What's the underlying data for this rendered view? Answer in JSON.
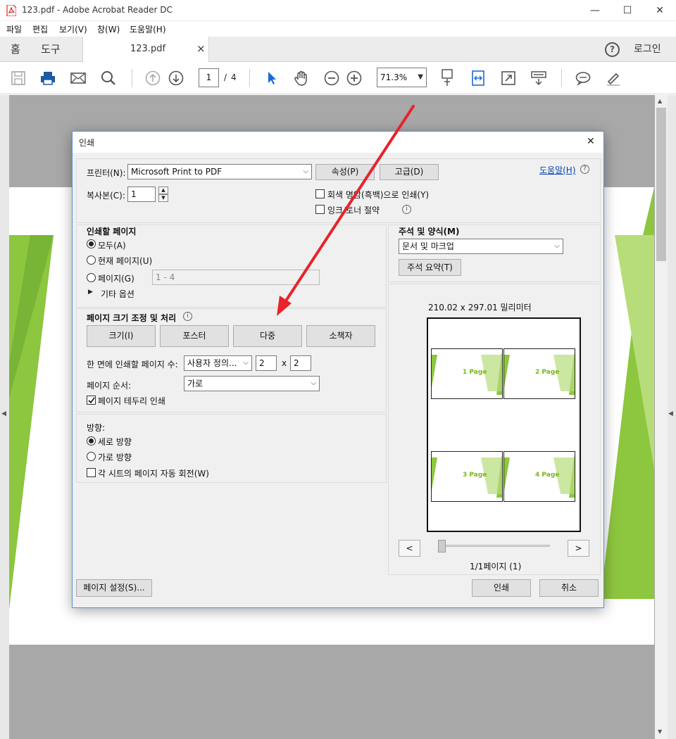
{
  "window": {
    "title": "123.pdf - Adobe Acrobat Reader DC",
    "minimize": "—",
    "maximize": "☐",
    "close": "✕"
  },
  "menu": [
    "파일",
    "편집",
    "보기(V)",
    "창(W)",
    "도움말(H)"
  ],
  "tabs": {
    "home": "홈",
    "tools": "도구",
    "doc": "123.pdf",
    "doc_close": "×",
    "login": "로그인",
    "help": "?"
  },
  "toolbar": {
    "page_current": "1",
    "page_sep": "/",
    "page_total": "4",
    "zoom": "71.3%"
  },
  "dialog": {
    "title": "인쇄",
    "close": "✕",
    "printer_label": "프린터(N):",
    "printer_value": "Microsoft Print to PDF",
    "properties_btn": "속성(P)",
    "advanced_btn": "고급(D)",
    "help_link": "도움말(H)",
    "copies_label": "복사본(C):",
    "copies_value": "1",
    "grayscale_label": "회색 명암(흑백)으로 인쇄(Y)",
    "save_ink_label": "잉크/토너 절약",
    "pages_title": "인쇄할 페이지",
    "pages_all": "모두(A)",
    "pages_current": "현재 페이지(U)",
    "pages_range": "페이지(G)",
    "pages_range_value": "1 - 4",
    "more_options": "기타 옵션",
    "sizing_title": "페이지 크기 조정 및 처리",
    "size_btn": "크기(I)",
    "poster_btn": "포스터",
    "multiple_btn": "다중",
    "booklet_btn": "소책자",
    "pages_per_sheet_label": "한 면에 인쇄할 페이지 수:",
    "pages_per_sheet_value": "사용자 정의...",
    "grid_x": "2",
    "grid_times": "x",
    "grid_y": "2",
    "page_order_label": "페이지 순서:",
    "page_order_value": "가로",
    "print_borders_label": "페이지 테두리 인쇄",
    "orientation_title": "방향:",
    "portrait": "세로 방향",
    "landscape": "가로 방향",
    "auto_rotate": "각 시트의 페이지 자동 회전(W)",
    "comments_title": "주석 및 양식(M)",
    "comments_value": "문서 및 마크업",
    "summarize_btn": "주석 요약(T)",
    "paper_size": "210.02 x 297.01 밀리미터",
    "thumbs": [
      "1 Page",
      "2 Page",
      "3 Page",
      "4 Page"
    ],
    "prev": "<",
    "next": ">",
    "page_count": "1/1페이지 (1)",
    "page_setup_btn": "페이지 설정(S)...",
    "print_btn": "인쇄",
    "cancel_btn": "취소"
  },
  "colors": {
    "accent": "#8dc63f",
    "annotation_arrow": "#e8232a",
    "link": "#0645ad"
  }
}
